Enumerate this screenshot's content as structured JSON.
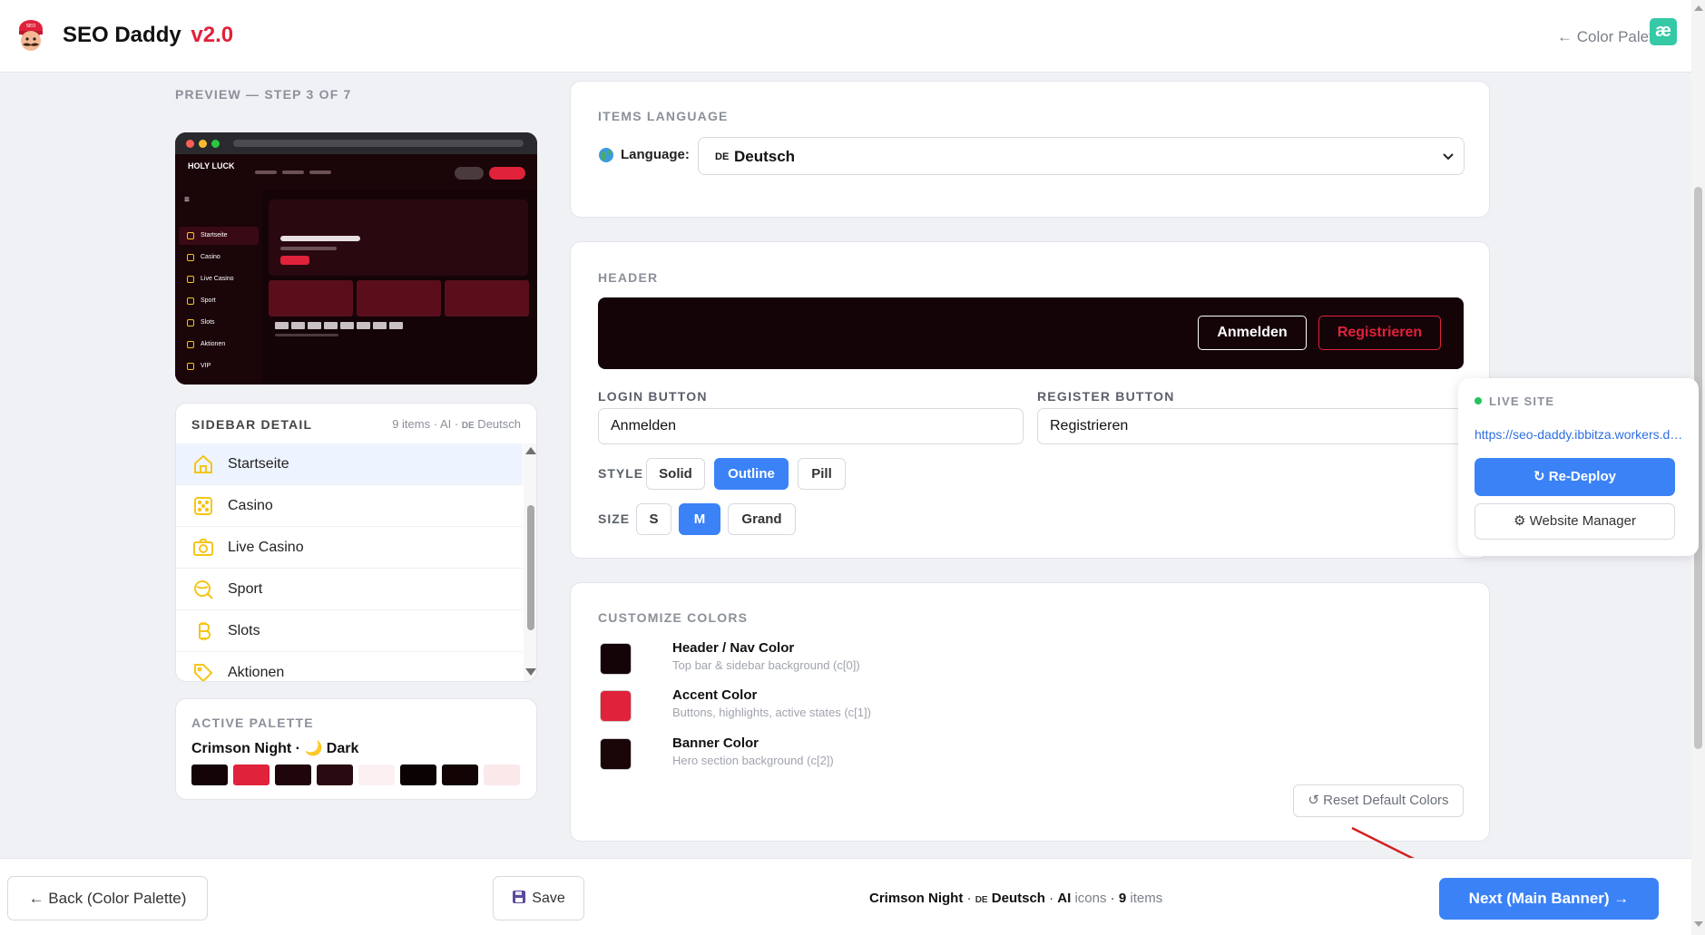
{
  "app": {
    "name": "SEO Daddy",
    "version": "v2.0",
    "back_link": "← Color Palette",
    "badge": "æ"
  },
  "preview": {
    "label": "PREVIEW — STEP 3 OF 7",
    "mock_logo": "HOLY LUCK",
    "mock_items": [
      "Startseite",
      "Casino",
      "Live Casino",
      "Sport",
      "Slots",
      "Aktionen",
      "VIP"
    ]
  },
  "sidebar_detail": {
    "title": "SIDEBAR DETAIL",
    "meta_prefix": "9 items · AI · ",
    "meta_lang_code": "DE",
    "meta_lang": " Deutsch",
    "items": [
      {
        "label": "Startseite",
        "icon": "home-icon"
      },
      {
        "label": "Casino",
        "icon": "dice-icon"
      },
      {
        "label": "Live Casino",
        "icon": "camera-icon"
      },
      {
        "label": "Sport",
        "icon": "sport-icon"
      },
      {
        "label": "Slots",
        "icon": "bitcoin-icon"
      },
      {
        "label": "Aktionen",
        "icon": "tag-icon"
      }
    ]
  },
  "active_palette": {
    "title": "ACTIVE PALETTE",
    "name": "Crimson Night · 🌙 Dark",
    "swatches": [
      "#140408",
      "#e0223a",
      "#1f060c",
      "#2a0a12",
      "#fdf0f2",
      "#0a0203",
      "#120305",
      "#fbe8eb"
    ]
  },
  "items_language": {
    "title": "ITEMS LANGUAGE",
    "label": "Language:",
    "selected_code": "DE",
    "selected": "Deutsch"
  },
  "header": {
    "title": "HEADER",
    "preview_login": "Anmelden",
    "preview_register": "Registrieren",
    "login_label": "LOGIN BUTTON",
    "login_value": "Anmelden",
    "register_label": "REGISTER BUTTON",
    "register_value": "Registrieren",
    "style_label": "STYLE",
    "style_options": [
      "Solid",
      "Outline",
      "Pill"
    ],
    "style_selected": "Outline",
    "size_label": "SIZE",
    "size_options": [
      "S",
      "M",
      "Grand"
    ],
    "size_selected": "M"
  },
  "customize_colors": {
    "title": "CUSTOMIZE COLORS",
    "rows": [
      {
        "name": "Header / Nav Color",
        "desc": "Top bar & sidebar background (c[0])",
        "color": "#140408"
      },
      {
        "name": "Accent Color",
        "desc": "Buttons, highlights, active states (c[1])",
        "color": "#e0223a"
      },
      {
        "name": "Banner Color",
        "desc": "Hero section background (c[2])",
        "color": "#1a0509"
      }
    ],
    "reset_label": "↺ Reset Default Colors"
  },
  "live_site": {
    "title": "LIVE SITE",
    "url": "https://seo-daddy.ibbitza.workers.dev",
    "redeploy_label": "↻ Re-Deploy",
    "manager_label": "⚙ Website Manager"
  },
  "footer": {
    "back_label": "← Back (Color Palette)",
    "save_label": "Save",
    "summary_palette": "Crimson Night",
    "summary_lang_code": "DE",
    "summary_lang": "Deutsch",
    "summary_ai": "AI",
    "summary_icons": "icons",
    "summary_count": "9",
    "summary_items": "items",
    "next_label": "Next (Main Banner) →"
  }
}
